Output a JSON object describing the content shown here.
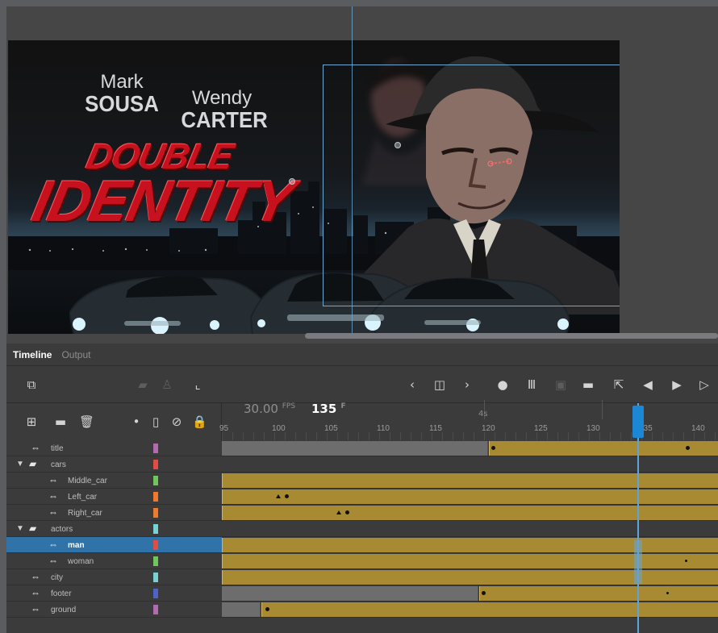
{
  "stage": {
    "actor_names": [
      {
        "first": "Mark",
        "last": "SOUSA"
      },
      {
        "first": "Wendy",
        "last": "CARTER"
      }
    ],
    "movie_title": [
      "DOUBLE",
      "IDENTITY"
    ]
  },
  "panel_tabs": [
    "Timeline",
    "Output"
  ],
  "timeline": {
    "fps": "30.00",
    "fps_unit": "FPS",
    "current_frame": "135",
    "frame_unit": "F",
    "seconds_marker": "4s",
    "ruler_labels": [
      "95",
      "100",
      "105",
      "110",
      "115",
      "120",
      "125",
      "130",
      "135",
      "140"
    ],
    "layers": [
      {
        "name": "title",
        "type": "layer",
        "color": "#b26ab2",
        "indent": 0
      },
      {
        "name": "cars",
        "type": "folder",
        "color": "#e24c45",
        "indent": 0
      },
      {
        "name": "Middle_car",
        "type": "layer",
        "color": "#6fc65d",
        "indent": 1
      },
      {
        "name": "Left_car",
        "type": "layer",
        "color": "#ee7b2d",
        "indent": 1
      },
      {
        "name": "Right_car",
        "type": "layer",
        "color": "#ee7b2d",
        "indent": 1
      },
      {
        "name": "actors",
        "type": "folder",
        "color": "#77d3d3",
        "indent": 0
      },
      {
        "name": "man",
        "type": "layer",
        "color": "#e24c45",
        "indent": 1
      },
      {
        "name": "woman",
        "type": "layer",
        "color": "#6fc65d",
        "indent": 1
      },
      {
        "name": "city",
        "type": "layer",
        "color": "#77d3d3",
        "indent": 0
      },
      {
        "name": "footer",
        "type": "layer",
        "color": "#4f63c6",
        "indent": 0
      },
      {
        "name": "ground",
        "type": "layer",
        "color": "#b26ab2",
        "indent": 0
      }
    ]
  },
  "colors": {
    "background": "#5a5c60",
    "timeline_panel": "#3b3b3b",
    "tween_frames": "#a88a32",
    "empty_frames": "#6d6d6d",
    "selection": "#2f73a8",
    "playhead": "#1c87d4",
    "title_red": "#c8111f"
  },
  "icons": [
    "layers-icon",
    "camera-icon",
    "layer-depth-icon",
    "graph-icon",
    "previous-frame-icon",
    "insert-keyframe-icon",
    "next-frame-icon",
    "onion-skin-icon",
    "edit-multiple-frames-icon",
    "frame-center-icon",
    "loop-icon",
    "step-back-icon",
    "play-icon",
    "step-forward-icon",
    "new-layer-icon",
    "new-folder-icon",
    "delete-layer-icon",
    "outline-icon",
    "visibility-icon",
    "lock-icon",
    "layer-visibility-icon"
  ]
}
